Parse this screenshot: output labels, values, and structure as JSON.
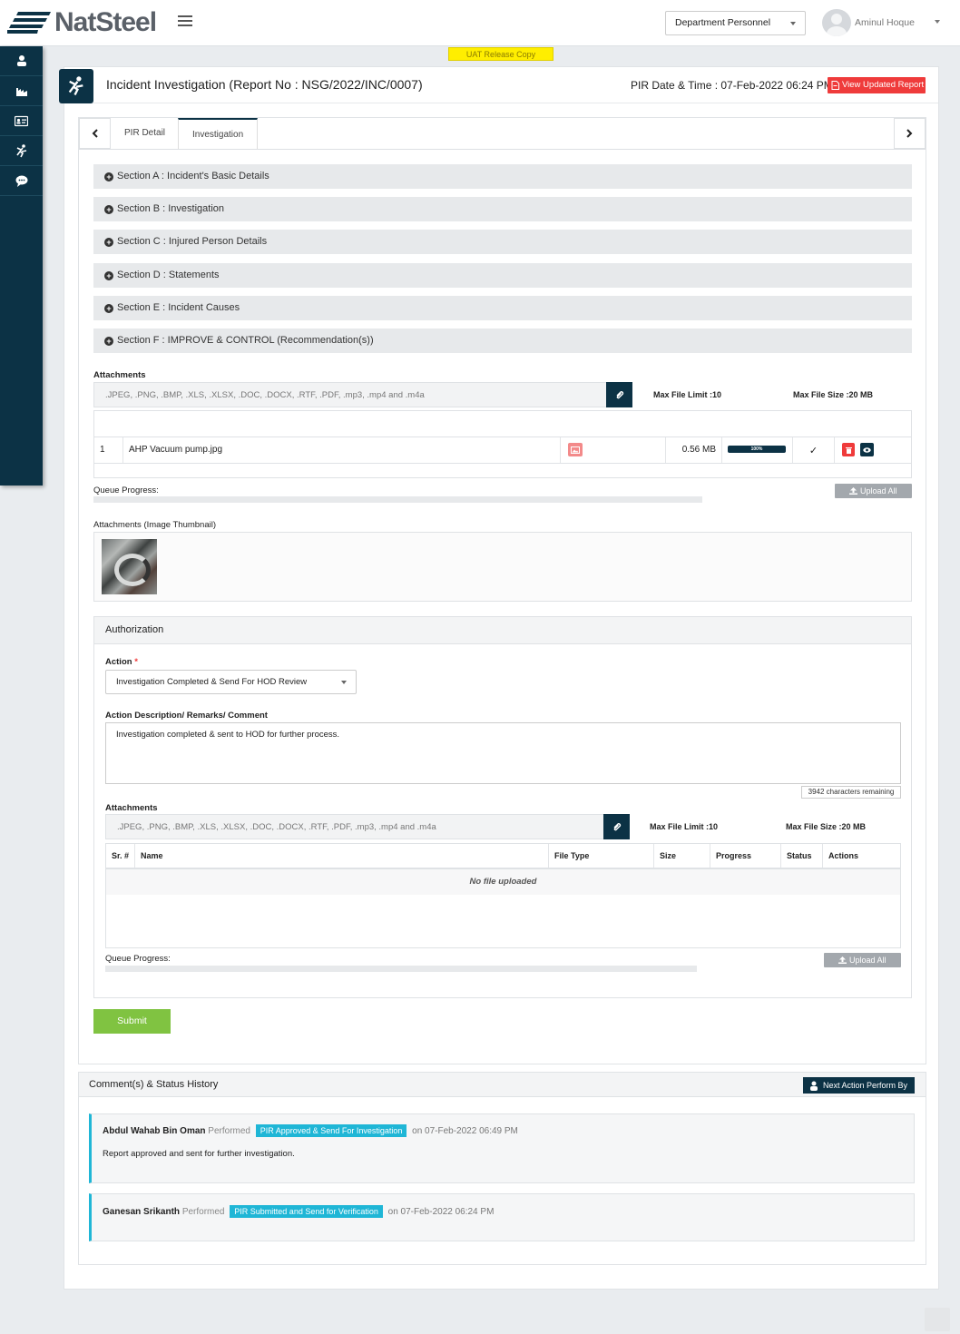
{
  "brand": {
    "name": "NatSteel"
  },
  "header": {
    "department": "Department Personnel",
    "user_name": "Aminul Hoque"
  },
  "banner": {
    "text": "UAT Release Copy"
  },
  "page": {
    "title": "Incident Investigation (Report No : NSG/2022/INC/0007)",
    "pir_datetime": "PIR Date & Time : 07-Feb-2022 06:24 PM",
    "view_button": "View Updated Report"
  },
  "tabs": [
    {
      "label": "PIR Detail",
      "active": false
    },
    {
      "label": "Investigation",
      "active": true
    }
  ],
  "sections": [
    {
      "label": "Section A : Incident's Basic Details"
    },
    {
      "label": "Section B : Investigation"
    },
    {
      "label": "Section C : Injured Person Details"
    },
    {
      "label": "Section D : Statements"
    },
    {
      "label": "Section E : Incident Causes"
    },
    {
      "label": "Section F : IMPROVE & CONTROL (Recommendation(s))"
    }
  ],
  "attachments": {
    "label": "Attachments",
    "placeholder": ".JPEG, .PNG, .BMP, .XLS, .XLSX, .DOC, .DOCX, .RTF, .PDF, .mp3, .mp4 and .m4a",
    "max_limit": "Max File Limit :10",
    "max_size": "Max File Size :20 MB",
    "files": [
      {
        "index": "1",
        "name": "AHP Vacuum pump.jpg",
        "size": "0.56 MB",
        "progress_label": "100%",
        "progress": 1.0,
        "status": "✓"
      }
    ],
    "queue_label": "Queue Progress:",
    "upload_all": "Upload All",
    "thumb_label": "Attachments (Image Thumbnail)"
  },
  "authorization": {
    "title": "Authorization",
    "action_label": "Action",
    "required_mark": "*",
    "action_value": "Investigation Completed & Send For HOD Review",
    "desc_label": "Action Description/ Remarks/ Comment",
    "desc_value": "Investigation completed & sent to HOD for further process.",
    "chars_remaining": "3942 characters remaining",
    "attach_label": "Attachments",
    "placeholder": ".JPEG, .PNG, .BMP, .XLS, .XLSX, .DOC, .DOCX, .RTF, .PDF, .mp3, .mp4 and .m4a",
    "max_limit": "Max File Limit :10",
    "max_size": "Max File Size :20 MB",
    "columns": [
      "Sr. #",
      "Name",
      "File Type",
      "Size",
      "Progress",
      "Status",
      "Actions"
    ],
    "empty_text": "No file uploaded",
    "queue_label": "Queue Progress:",
    "upload_all": "Upload All"
  },
  "submit_label": "Submit",
  "comments": {
    "title": "Comment(s) & Status History",
    "next_button": "Next Action Perform By",
    "entries": [
      {
        "name": "Abdul Wahab Bin Oman",
        "performed": "Performed",
        "status": "PIR Approved & Send For Investigation",
        "date": "on 07-Feb-2022 06:49 PM",
        "remark": "Report approved and sent for further investigation."
      },
      {
        "name": "Ganesan Srikanth",
        "performed": "Performed",
        "status": "PIR Submitted and Send for Verification",
        "date": "on 07-Feb-2022 06:24 PM",
        "remark": ""
      }
    ]
  },
  "colors": {
    "navy": "#0c3245",
    "danger": "#ef3b3b",
    "success": "#80c341",
    "info": "#1fb6d6",
    "banner": "#ffee00"
  }
}
